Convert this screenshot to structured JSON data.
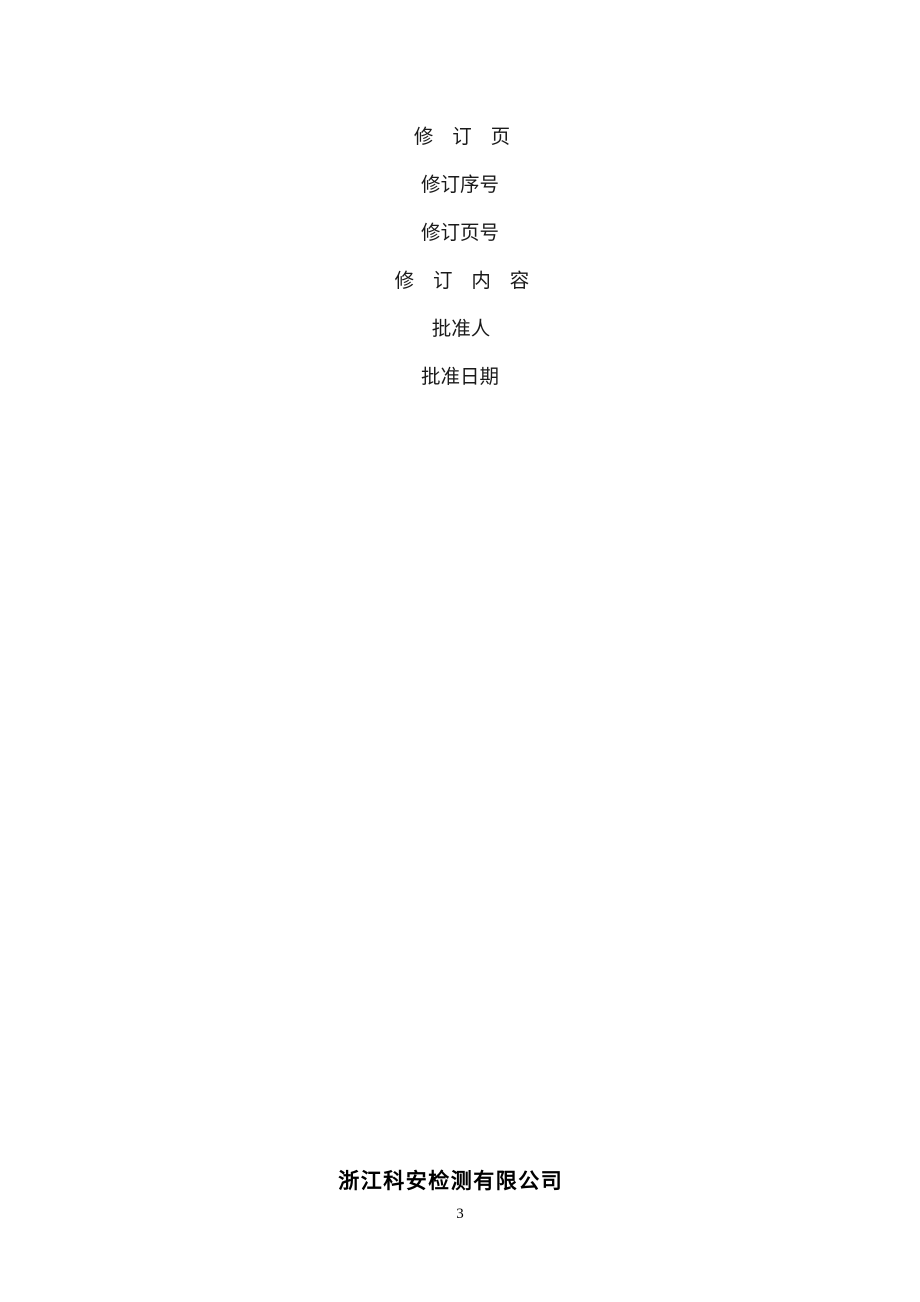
{
  "document": {
    "page_number": "3",
    "body_lines": [
      {
        "text": "修 订 页",
        "spacing": "wide"
      },
      {
        "text": "修订序号",
        "spacing": "normal"
      },
      {
        "text": "修订页号",
        "spacing": "normal"
      },
      {
        "text": "修 订 内 容",
        "spacing": "wide"
      },
      {
        "text": "批准人",
        "spacing": "normal"
      },
      {
        "text": "批准日期",
        "spacing": "normal"
      }
    ],
    "footer": {
      "company_name": "浙江科安检测有限公司"
    }
  },
  "colors": {
    "page_background": "#ffffff",
    "body_text": "#1a1a1a",
    "footer_text": "#000000"
  }
}
